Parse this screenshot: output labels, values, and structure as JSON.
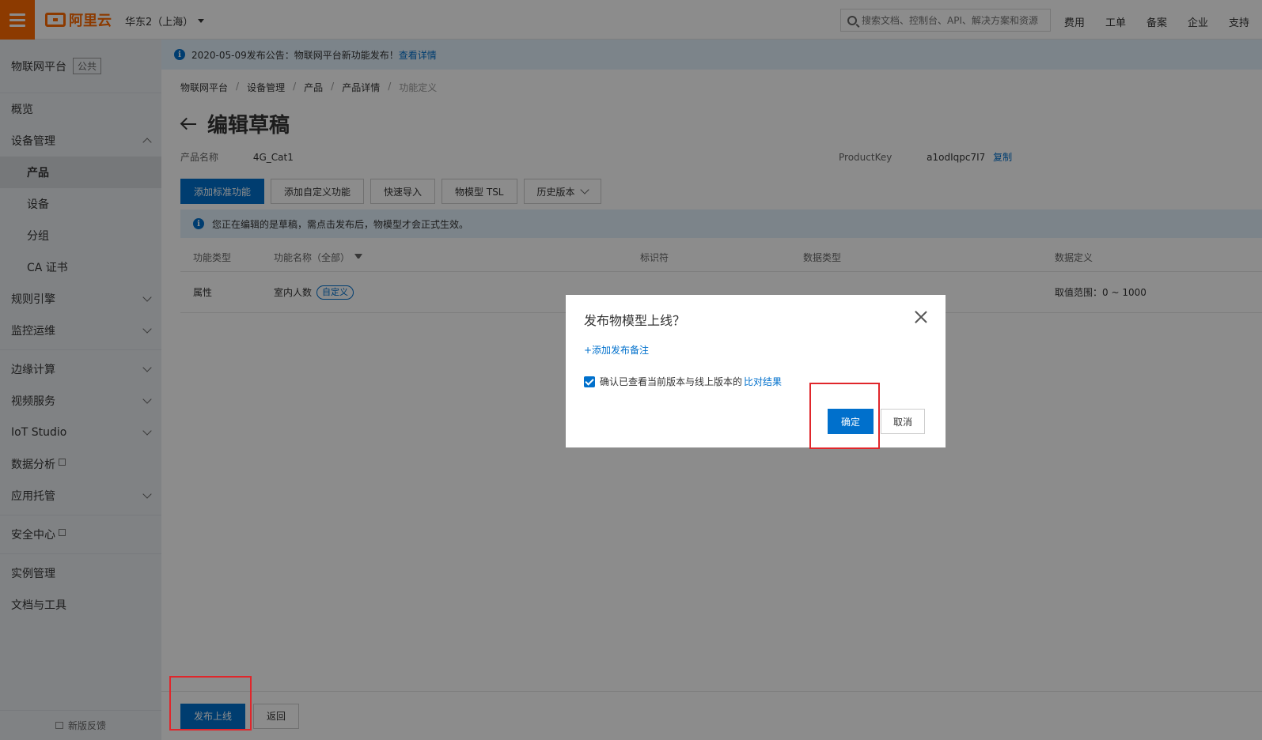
{
  "topbar": {
    "logo_text": "阿里云",
    "region": "华东2（上海）",
    "search_placeholder": "搜索文档、控制台、API、解决方案和资源",
    "nav": [
      "费用",
      "工单",
      "备案",
      "企业",
      "支持"
    ]
  },
  "sidebar": {
    "platform": "物联网平台",
    "tag": "公共",
    "items": {
      "overview": "概览",
      "device_mgmt": "设备管理",
      "product": "产品",
      "device": "设备",
      "group": "分组",
      "ca_cert": "CA 证书",
      "rule_engine": "规则引擎",
      "monitor": "监控运维",
      "edge": "边缘计算",
      "video": "视频服务",
      "iot_studio": "IoT Studio",
      "data_analysis": "数据分析",
      "app_hosting": "应用托管",
      "security": "安全中心",
      "instance": "实例管理",
      "docs_tools": "文档与工具"
    },
    "feedback": "新版反馈"
  },
  "notice": {
    "text": "2020-05-09发布公告：物联网平台新功能发布！",
    "link": "查看详情"
  },
  "breadcrumb": [
    "物联网平台",
    "设备管理",
    "产品",
    "产品详情",
    "功能定义"
  ],
  "page": {
    "title": "编辑草稿",
    "product_name_label": "产品名称",
    "product_name": "4G_Cat1",
    "product_key_label": "ProductKey",
    "product_key": "a1odIqpc7I7",
    "copy": "复制"
  },
  "toolbar": {
    "add_standard": "添加标准功能",
    "add_custom": "添加自定义功能",
    "quick_import": "快速导入",
    "tsl": "物模型 TSL",
    "history": "历史版本"
  },
  "draft_tip": "您正在编辑的是草稿，需点击发布后，物模型才会正式生效。",
  "table": {
    "headers": {
      "type": "功能类型",
      "name": "功能名称（全部）",
      "identifier": "标识符",
      "data_type": "数据类型",
      "definition": "数据定义"
    },
    "rows": [
      {
        "type": "属性",
        "name": "室内人数",
        "tag": "自定义",
        "definition": "取值范围：0 ~ 1000"
      }
    ]
  },
  "bottom": {
    "publish": "发布上线",
    "back": "返回"
  },
  "dialog": {
    "title": "发布物模型上线？",
    "add_note": "+添加发布备注",
    "confirm_text": "确认已查看当前版本与线上版本的",
    "compare_link": "比对结果",
    "ok": "确定",
    "cancel": "取消"
  },
  "colors": {
    "brand": "#ff6a00",
    "primary": "#0070cc",
    "highlight": "#e0262b"
  }
}
